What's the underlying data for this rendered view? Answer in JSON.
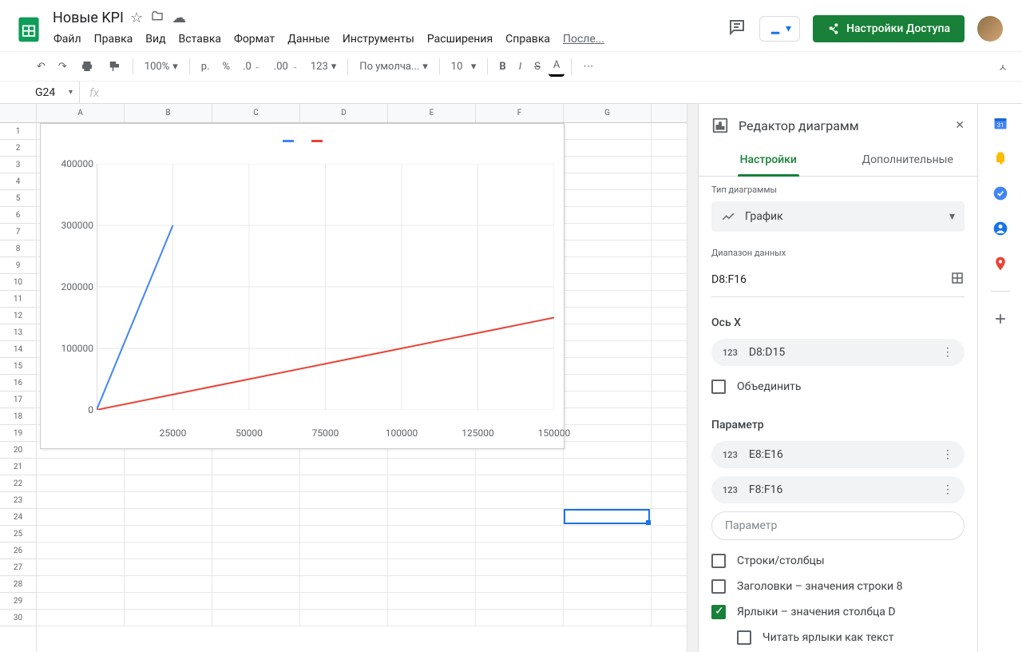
{
  "doc": {
    "title": "Новые KPI",
    "menus": [
      "Файл",
      "Правка",
      "Вид",
      "Вставка",
      "Формат",
      "Данные",
      "Инструменты",
      "Расширения",
      "Справка"
    ],
    "last_edit": "После...",
    "share_label": "Настройки Доступа"
  },
  "toolbar": {
    "zoom": "100%",
    "currency": "р.",
    "percent": "%",
    "dec_dec": ".0",
    "dec_inc": ".00",
    "num_fmt": "123",
    "font": "По умолча...",
    "font_size": "10"
  },
  "cellref": {
    "name_box": "G24",
    "fx": "fx"
  },
  "grid": {
    "columns": [
      "A",
      "B",
      "C",
      "D",
      "E",
      "F",
      "G"
    ],
    "row_count": 30
  },
  "chart_data": {
    "type": "line",
    "x": [
      0,
      25000,
      50000,
      75000,
      100000,
      125000,
      150000
    ],
    "series": [
      {
        "name": "",
        "color": "#4285f4",
        "values": [
          0,
          300000,
          null,
          null,
          null,
          null,
          null
        ]
      },
      {
        "name": "",
        "color": "#ea4335",
        "values": [
          0,
          25000,
          50000,
          75000,
          100000,
          125000,
          150000
        ]
      }
    ],
    "ylim": [
      0,
      400000
    ],
    "yticks": [
      0,
      100000,
      200000,
      300000,
      400000
    ],
    "xticks": [
      25000,
      50000,
      75000,
      100000,
      125000,
      150000
    ]
  },
  "editor": {
    "title": "Редактор диаграмм",
    "tab_setup": "Настройки",
    "tab_customize": "Дополнительные",
    "chart_type_label": "Тип диаграммы",
    "chart_type_value": "График",
    "data_range_label": "Диапазон данных",
    "data_range_value": "D8:F16",
    "x_axis_title": "Ось X",
    "x_axis_value": "D8:D15",
    "combine_label": "Объединить",
    "series_title": "Параметр",
    "series": [
      "E8:E16",
      "F8:F16"
    ],
    "add_series_placeholder": "Параметр",
    "check_row_col": "Строки/столбцы",
    "check_headers": "Заголовки – значения строки 8",
    "check_labels": "Ярлыки – значения столбца D",
    "check_labels_checked": true,
    "check_text_labels": "Читать ярлыки как текст"
  },
  "rail_icons": [
    "calendar",
    "keep",
    "tasks",
    "contacts",
    "maps",
    "add"
  ]
}
